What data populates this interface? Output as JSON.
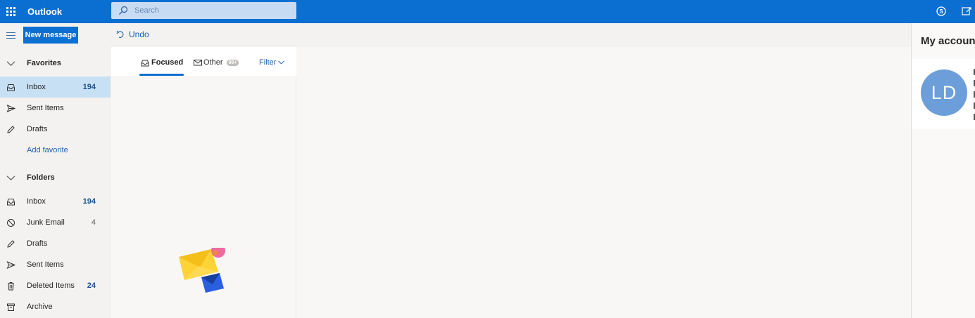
{
  "app": {
    "title": "Outlook"
  },
  "search": {
    "placeholder": "Search"
  },
  "toolbar": {
    "new_message_label": "New message",
    "undo_label": "Undo"
  },
  "nav": {
    "favorites_label": "Favorites",
    "favorites": [
      {
        "label": "Inbox",
        "count": "194",
        "icon": "inbox-icon",
        "selected": true
      },
      {
        "label": "Sent Items",
        "count": "",
        "icon": "send-icon"
      },
      {
        "label": "Drafts",
        "count": "",
        "icon": "pencil-icon"
      }
    ],
    "add_favorite_label": "Add favorite",
    "folders_label": "Folders",
    "folders": [
      {
        "label": "Inbox",
        "count": "194",
        "icon": "inbox-icon"
      },
      {
        "label": "Junk Email",
        "count": "4",
        "icon": "block-icon"
      },
      {
        "label": "Drafts",
        "count": "",
        "icon": "pencil-icon"
      },
      {
        "label": "Sent Items",
        "count": "",
        "icon": "send-icon"
      },
      {
        "label": "Deleted Items",
        "count": "24",
        "icon": "trash-icon"
      },
      {
        "label": "Archive",
        "count": "",
        "icon": "archive-icon"
      }
    ]
  },
  "message_list": {
    "tabs": [
      {
        "label": "Focused",
        "active": true
      },
      {
        "label": "Other",
        "badge": "99+"
      }
    ],
    "filter_label": "Filter"
  },
  "account_panel": {
    "title": "My account",
    "avatar_initials": "LD",
    "avatar_color": "#6c9fd9"
  },
  "colors": {
    "brand": "#0b6fd1",
    "selected_nav": "#c7e0f4",
    "link": "#1f5fb0"
  }
}
